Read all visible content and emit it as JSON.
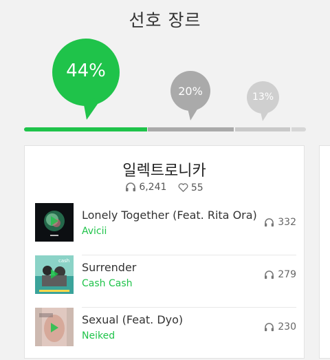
{
  "header": {
    "title": "선호 장르"
  },
  "colors": {
    "green": "#1fc34a",
    "gray_dark": "#aaaaaa",
    "gray_light": "#c9c9c9",
    "gray_lighter": "#d6d6d6"
  },
  "genre_share": {
    "bubbles": [
      {
        "label": "44%",
        "value": 44
      },
      {
        "label": "20%",
        "value": 20
      },
      {
        "label": "13%",
        "value": 13
      }
    ]
  },
  "genre_card": {
    "title": "일렉트로니카",
    "listens": "6,241",
    "likes": "55",
    "tracks": [
      {
        "title": "Lonely Together (Feat. Rita Ora)",
        "artist": "Avicii",
        "plays": "332",
        "cover_icon": "album-cover-lonely-together"
      },
      {
        "title": "Surrender",
        "artist": "Cash Cash",
        "plays": "279",
        "cover_icon": "album-cover-surrender"
      },
      {
        "title": "Sexual (Feat. Dyo)",
        "artist": "Neiked",
        "plays": "230",
        "cover_icon": "album-cover-sexual"
      }
    ]
  }
}
